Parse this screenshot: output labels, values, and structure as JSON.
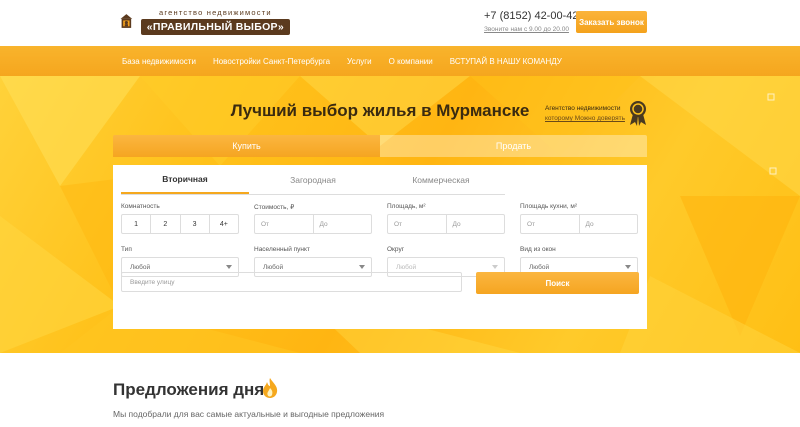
{
  "header": {
    "logo_top": "агентство недвижимости",
    "logo_main": "«ПРАВИЛЬНЫЙ ВЫБОР»",
    "phone": "+7 (8152) 42-00-42",
    "hours": "Звоните нам с 9.00 до 20.00",
    "callback_label": "Заказать звонок"
  },
  "nav": {
    "items": [
      "База недвижимости",
      "Новостройки Санкт-Петербурга",
      "Услуги",
      "О компании",
      "ВСТУПАЙ В НАШУ КОМАНДУ"
    ]
  },
  "hero": {
    "title": "Лучший выбор жилья в Мурманске",
    "agency_line1": "Агентство недвижимости",
    "agency_line2": "которому Можно доверять"
  },
  "tabs": {
    "buy": "Купить",
    "sell": "Продать"
  },
  "sub_tabs": [
    "Вторичная",
    "Загородная",
    "Коммерческая"
  ],
  "filters": {
    "rooms_label": "Комнатность",
    "rooms": [
      "1",
      "2",
      "3",
      "4+"
    ],
    "price_label": "Стоимость, ₽",
    "area_label": "Площадь, м²",
    "kitchen_label": "Площадь кухни, м²",
    "from": "От",
    "to": "До",
    "type_label": "Тип",
    "type_value": "Любой",
    "locality_label": "Населенный пункт",
    "locality_value": "Любой",
    "district_label": "Округ",
    "district_value": "Любой",
    "view_label": "Вид из окон",
    "view_value": "Любой",
    "street_placeholder": "Введите улицу",
    "search_label": "Поиск"
  },
  "offers": {
    "title": "Предложения дня",
    "subtitle": "Мы подобрали для вас самые актуальные и выгодные предложения"
  },
  "colors": {
    "accent": "#f5a81e",
    "brand_brown": "#5b3a1e"
  }
}
